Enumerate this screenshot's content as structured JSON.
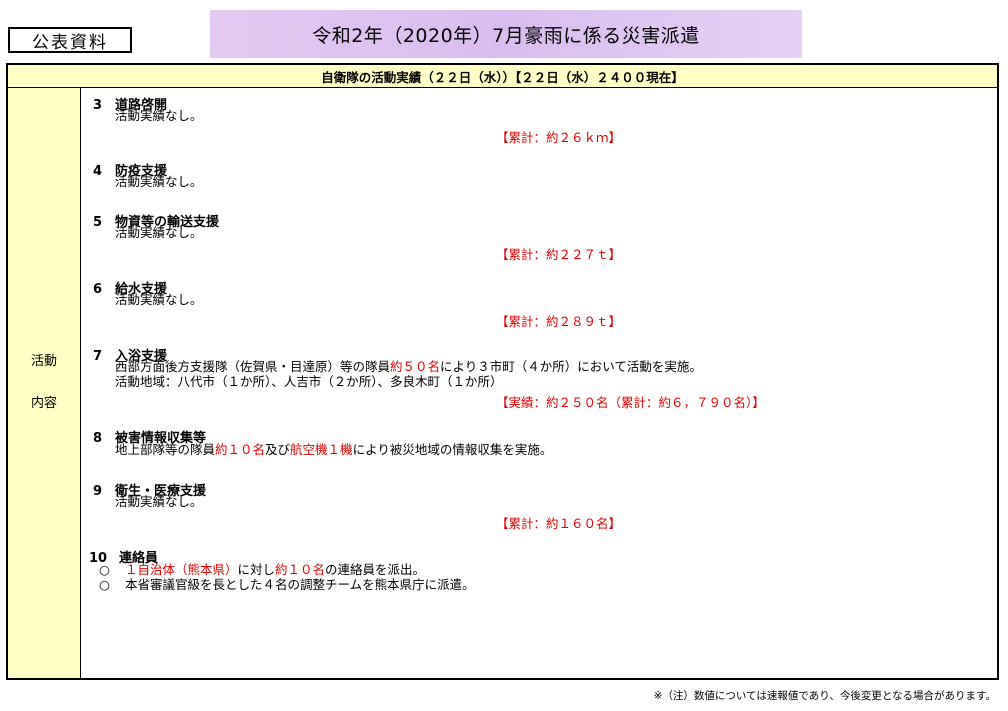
{
  "badge": "公表資料",
  "title": "令和2年（2020年）7月豪雨に係る災害派遣",
  "table_header": "自衛隊の活動実績（２２日（水））【２２日（水）２４００現在】",
  "side_label": [
    "活動",
    "内容"
  ],
  "sections": [
    {
      "num": "3",
      "heading": "道路啓開",
      "line1": "活動実績なし。",
      "total": "【累計：約２６ｋｍ】"
    },
    {
      "num": "4",
      "heading": "防疫支援",
      "line1": "活動実績なし。"
    },
    {
      "num": "5",
      "heading": "物資等の輸送支援",
      "line1": "活動実績なし。",
      "total": "【累計：約２２７ｔ】"
    },
    {
      "num": "6",
      "heading": "給水支援",
      "line1": "活動実績なし。",
      "total": "【累計：約２８９ｔ】"
    },
    {
      "num": "7",
      "heading": "入浴支援",
      "line1_a": "西部方面後方支援隊（佐賀県・目達原）等の隊員",
      "line1_b": "約５０名",
      "line1_c": "により３市町（４か所）において活動を実施。",
      "line2": "活動地域：八代市（１か所）、人吉市（２か所）、多良木町（１か所）",
      "total": "【実績：約２５０名（累計：約６，７９０名）】"
    },
    {
      "num": "8",
      "heading": "被害情報収集等",
      "line1_a": "地上部隊等の隊員",
      "line1_b": "約１０名",
      "line1_c": "及び",
      "line1_d": "航空機１機",
      "line1_e": "により被災地域の情報収集を実施。"
    },
    {
      "num": "9",
      "heading": "衛生・医療支援",
      "line1": "活動実績なし。",
      "total": "【累計：約１６０名】"
    },
    {
      "num": "10",
      "heading": "連絡員",
      "bullets": [
        {
          "icon": "○",
          "a": "１自治体（熊本県）",
          "b": "に対し",
          "c": "約１０名",
          "d": "の連絡員を派出。"
        },
        {
          "icon": "○",
          "a": "本省審議官級を長とした４名の調整チームを熊本県庁に派遣。"
        }
      ]
    }
  ],
  "footnote": "※（注）数値については速報値であり、今後変更となる場合があります。",
  "colors": {
    "header_bg": "#ffffc6",
    "banner": "#dcc2f0",
    "accent_red": "#e00000"
  }
}
